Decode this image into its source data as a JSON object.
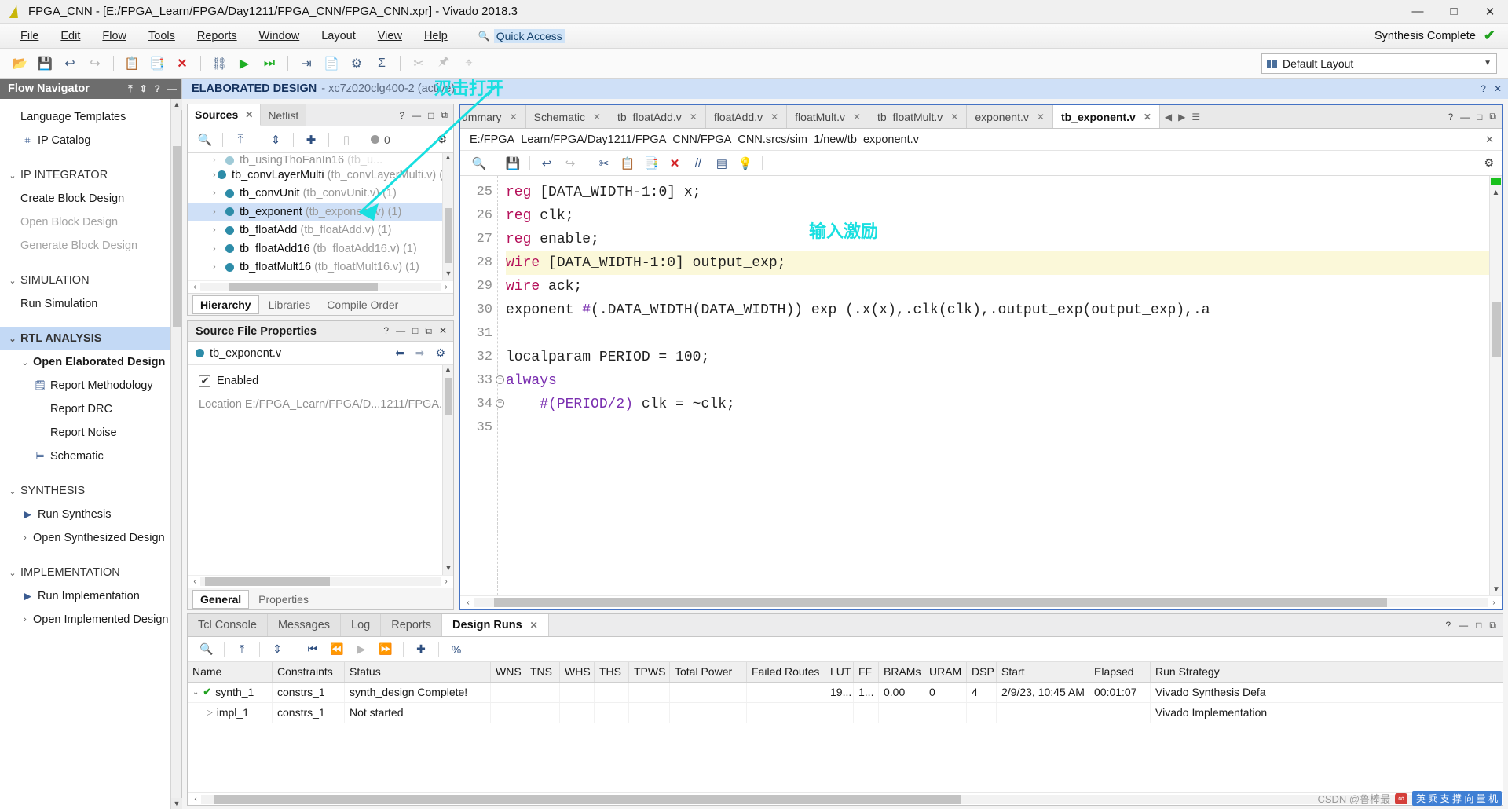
{
  "window": {
    "title": "FPGA_CNN - [E:/FPGA_Learn/FPGA/Day1211/FPGA_CNN/FPGA_CNN.xpr] - Vivado 2018.3",
    "minimize": "—",
    "maximize": "□",
    "close": "✕"
  },
  "menu": {
    "items": [
      "File",
      "Edit",
      "Flow",
      "Tools",
      "Reports",
      "Window",
      "Layout",
      "View",
      "Help"
    ],
    "quick_access_placeholder": "Quick Access",
    "quick_access_value": "Quick Access",
    "status": "Synthesis Complete",
    "status_check": "✔"
  },
  "toolbar": {
    "layout_label": "Default Layout"
  },
  "flow_navigator": {
    "title": "Flow Navigator",
    "items": [
      {
        "label": "Language Templates",
        "level": 2,
        "icon": "",
        "state": "normal"
      },
      {
        "label": "IP Catalog",
        "level": 2,
        "icon": "ip-catalog-icon",
        "state": "normal"
      },
      {
        "label": "IP INTEGRATOR",
        "level": 0,
        "icon": "chevron-down-icon",
        "state": "section"
      },
      {
        "label": "Create Block Design",
        "level": 2,
        "icon": "",
        "state": "normal"
      },
      {
        "label": "Open Block Design",
        "level": 2,
        "icon": "",
        "state": "disabled"
      },
      {
        "label": "Generate Block Design",
        "level": 2,
        "icon": "",
        "state": "disabled"
      },
      {
        "label": "SIMULATION",
        "level": 0,
        "icon": "chevron-down-icon",
        "state": "section"
      },
      {
        "label": "Run Simulation",
        "level": 2,
        "icon": "",
        "state": "normal"
      },
      {
        "label": "RTL ANALYSIS",
        "level": 0,
        "icon": "chevron-down-icon",
        "state": "section-active"
      },
      {
        "label": "Open Elaborated Design",
        "level": 1,
        "icon": "chevron-down-icon",
        "state": "bold"
      },
      {
        "label": "Report Methodology",
        "level": 2,
        "icon": "clipboard-check-icon",
        "state": "normal"
      },
      {
        "label": "Report DRC",
        "level": 2,
        "icon": "",
        "state": "normal"
      },
      {
        "label": "Report Noise",
        "level": 2,
        "icon": "",
        "state": "normal"
      },
      {
        "label": "Schematic",
        "level": 2,
        "icon": "schematic-icon",
        "state": "normal"
      },
      {
        "label": "SYNTHESIS",
        "level": 0,
        "icon": "chevron-down-icon",
        "state": "section"
      },
      {
        "label": "Run Synthesis",
        "level": 1,
        "icon": "play-icon",
        "state": "normal"
      },
      {
        "label": "Open Synthesized Design",
        "level": 1,
        "icon": "chevron-right-icon",
        "state": "normal"
      },
      {
        "label": "IMPLEMENTATION",
        "level": 0,
        "icon": "chevron-down-icon",
        "state": "section"
      },
      {
        "label": "Run Implementation",
        "level": 1,
        "icon": "play-icon",
        "state": "normal"
      },
      {
        "label": "Open Implemented Design",
        "level": 1,
        "icon": "chevron-right-icon",
        "state": "normal"
      }
    ]
  },
  "workspace_banner": {
    "title": "ELABORATED DESIGN",
    "subtitle": "- xc7z020clg400-2  (active)"
  },
  "sources_panel": {
    "tabs": [
      {
        "label": "Sources",
        "active": true,
        "closable": true
      },
      {
        "label": "Netlist",
        "active": false,
        "closable": false
      }
    ],
    "toolbar_count": "0",
    "tree": [
      {
        "name": "tb_usingThoFanIn16",
        "file": "(tb_u...",
        "count": "",
        "selected": false,
        "clipped": true
      },
      {
        "name": "tb_convLayerMulti",
        "file": "(tb_convLayerMulti.v)",
        "count": "(1)",
        "selected": false
      },
      {
        "name": "tb_convUnit",
        "file": "(tb_convUnit.v)",
        "count": "(1)",
        "selected": false
      },
      {
        "name": "tb_exponent",
        "file": "(tb_exponent.v)",
        "count": "(1)",
        "selected": true
      },
      {
        "name": "tb_floatAdd",
        "file": "(tb_floatAdd.v)",
        "count": "(1)",
        "selected": false
      },
      {
        "name": "tb_floatAdd16",
        "file": "(tb_floatAdd16.v)",
        "count": "(1)",
        "selected": false
      },
      {
        "name": "tb_floatMult16",
        "file": "(tb_floatMult16.v)",
        "count": "(1)",
        "selected": false
      }
    ],
    "bottom_tabs": [
      {
        "label": "Hierarchy",
        "active": true
      },
      {
        "label": "Libraries",
        "active": false
      },
      {
        "label": "Compile Order",
        "active": false
      }
    ]
  },
  "source_properties": {
    "title": "Source File Properties",
    "file_name": "tb_exponent.v",
    "enabled_label": "Enabled",
    "location_row": "Location            E:/FPGA_Learn/FPGA/D...1211/FPGA...",
    "tabs": [
      {
        "label": "General",
        "active": true
      },
      {
        "label": "Properties",
        "active": false
      }
    ]
  },
  "editor": {
    "tabs": [
      {
        "label": "ummary",
        "active": false,
        "clipped": true
      },
      {
        "label": "Schematic",
        "active": false
      },
      {
        "label": "tb_floatAdd.v",
        "active": false
      },
      {
        "label": "floatAdd.v",
        "active": false
      },
      {
        "label": "floatMult.v",
        "active": false
      },
      {
        "label": "tb_floatMult.v",
        "active": false
      },
      {
        "label": "exponent.v",
        "active": false
      },
      {
        "label": "tb_exponent.v",
        "active": true
      }
    ],
    "path": "E:/FPGA_Learn/FPGA/Day1211/FPGA_CNN/FPGA_CNN.srcs/sim_1/new/tb_exponent.v",
    "code": [
      {
        "num": "25",
        "text": "reg [DATA_WIDTH-1:0] x;",
        "highlight": false,
        "fold": false
      },
      {
        "num": "26",
        "text": "reg clk;",
        "highlight": false,
        "fold": false
      },
      {
        "num": "27",
        "text": "reg enable;",
        "highlight": false,
        "fold": false
      },
      {
        "num": "28",
        "text": "wire [DATA_WIDTH-1:0] output_exp;",
        "highlight": true,
        "fold": false
      },
      {
        "num": "29",
        "text": "wire ack;",
        "highlight": false,
        "fold": false
      },
      {
        "num": "30",
        "text": "exponent #(.DATA_WIDTH(DATA_WIDTH)) exp (.x(x),.clk(clk),.output_exp(output_exp),.a",
        "highlight": false,
        "fold": false
      },
      {
        "num": "31",
        "text": "",
        "highlight": false,
        "fold": false
      },
      {
        "num": "32",
        "text": "localparam PERIOD = 100;",
        "highlight": false,
        "fold": false
      },
      {
        "num": "33",
        "text": "always",
        "highlight": false,
        "fold": true
      },
      {
        "num": "34",
        "text": "    #(PERIOD/2) clk = ~clk;",
        "highlight": false,
        "fold": true
      },
      {
        "num": "35",
        "text": "",
        "highlight": false,
        "fold": false
      }
    ]
  },
  "bottom_panel": {
    "tabs": [
      {
        "label": "Tcl Console",
        "active": false,
        "closable": false
      },
      {
        "label": "Messages",
        "active": false,
        "closable": false
      },
      {
        "label": "Log",
        "active": false,
        "closable": false
      },
      {
        "label": "Reports",
        "active": false,
        "closable": false
      },
      {
        "label": "Design Runs",
        "active": true,
        "closable": true
      }
    ],
    "columns": [
      "Name",
      "Constraints",
      "Status",
      "WNS",
      "TNS",
      "WHS",
      "THS",
      "TPWS",
      "Total Power",
      "Failed Routes",
      "LUT",
      "FF",
      "BRAMs",
      "URAM",
      "DSP",
      "Start",
      "Elapsed",
      "Run Strategy"
    ],
    "rows": [
      {
        "name": "synth_1",
        "constraints": "constrs_1",
        "status": "synth_design Complete!",
        "wns": "",
        "tns": "",
        "whs": "",
        "ths": "",
        "tpws": "",
        "total_power": "",
        "failed_routes": "",
        "lut": "19...",
        "ff": "1...",
        "brams": "0.00",
        "uram": "0",
        "dsp": "4",
        "start": "2/9/23, 10:45 AM",
        "elapsed": "00:01:07",
        "strategy": "Vivado Synthesis Defa"
      },
      {
        "name": "impl_1",
        "constraints": "constrs_1",
        "status": "Not started",
        "wns": "",
        "tns": "",
        "whs": "",
        "ths": "",
        "tpws": "",
        "total_power": "",
        "failed_routes": "",
        "lut": "",
        "ff": "",
        "brams": "",
        "uram": "",
        "dsp": "",
        "start": "",
        "elapsed": "",
        "strategy": "Vivado Implementation"
      }
    ]
  },
  "annotations": {
    "double_click_open": "双击打开",
    "input_stimulus": "输入激励",
    "accent_color": "#18dfe0"
  },
  "watermark": {
    "text": "CSDN @鲁棒最",
    "chip": "英 乘 支 撑 向 量 机"
  }
}
